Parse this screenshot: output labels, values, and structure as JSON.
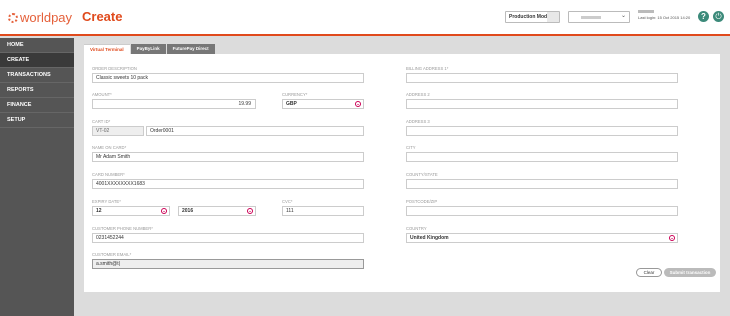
{
  "header": {
    "logo_text": "worldpay",
    "page_title": "Create",
    "mode_select": "Production Mode",
    "last_login": "Last login: 15 Oct 2015 14:20"
  },
  "sidebar": {
    "items": [
      {
        "label": "HOME"
      },
      {
        "label": "CREATE"
      },
      {
        "label": "TRANSACTIONS"
      },
      {
        "label": "REPORTS"
      },
      {
        "label": "FINANCE"
      },
      {
        "label": "SETUP"
      }
    ]
  },
  "tabs": [
    {
      "label": "Virtual Terminal"
    },
    {
      "label": "PayByLink"
    },
    {
      "label": "FuturePay Direct"
    }
  ],
  "form": {
    "order_description": {
      "label": "ORDER DESCRIPTION",
      "value": "Classic sweets 10 pack"
    },
    "amount": {
      "label": "AMOUNT*",
      "value": "19.99"
    },
    "currency": {
      "label": "CURRENCY*",
      "value": "GBP"
    },
    "cart_id": {
      "label": "CART ID*",
      "prefix": "VT-02",
      "value": "Order0001"
    },
    "name_on_card": {
      "label": "NAME ON CARD*",
      "value": "Mr Adam Smith"
    },
    "card_number": {
      "label": "CARD NUMBER*",
      "value": "4001XXXXXXXX1683"
    },
    "expiry_date": {
      "label": "EXPIRY DATE*",
      "month": "12",
      "year": "2016"
    },
    "cvc": {
      "label": "CVC*",
      "value": "111"
    },
    "customer_phone": {
      "label": "CUSTOMER PHONE NUMBER*",
      "value": "0231452244"
    },
    "customer_email": {
      "label": "CUSTOMER EMAIL*",
      "value": "a.smith@t|"
    },
    "billing_address_1": {
      "label": "BILLING ADDRESS 1*",
      "value": ""
    },
    "address_2": {
      "label": "ADDRESS 2",
      "value": ""
    },
    "address_3": {
      "label": "ADDRESS 3",
      "value": ""
    },
    "city": {
      "label": "CITY",
      "value": ""
    },
    "county_state": {
      "label": "COUNTY/STATE",
      "value": ""
    },
    "postcode_zip": {
      "label": "POSTCODE/ZIP",
      "value": ""
    },
    "country": {
      "label": "COUNTRY",
      "value": "United Kingdom"
    }
  },
  "buttons": {
    "clear": "Clear",
    "submit": "Submit transaction"
  },
  "colors": {
    "accent": "#e04a1c",
    "sidebar": "#555555",
    "icon_teal": "#3c8a7a"
  }
}
